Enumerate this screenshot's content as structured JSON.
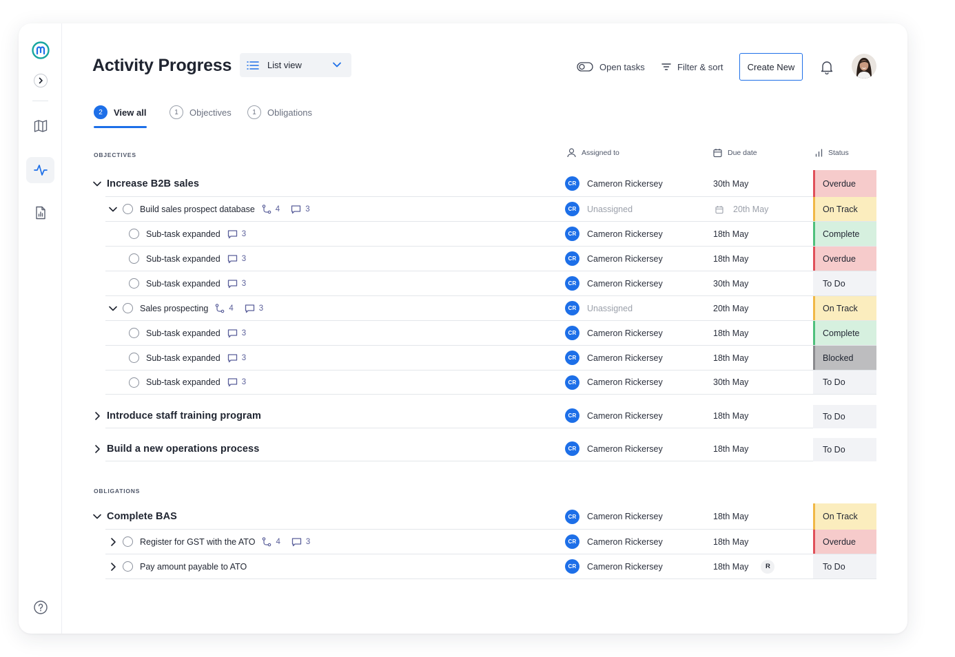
{
  "page": {
    "title": "Activity Progress",
    "view_selector": {
      "label": "List view",
      "icon": "list-icon"
    }
  },
  "header_actions": {
    "open_tasks": "Open tasks",
    "filter_sort": "Filter & sort",
    "create_new": "Create New"
  },
  "sidebar": {
    "items": [
      {
        "name": "logo",
        "icon": "logo-icon"
      },
      {
        "name": "expand",
        "icon": "chevron-right-icon"
      },
      {
        "name": "map",
        "icon": "map-icon"
      },
      {
        "name": "activity",
        "icon": "activity-icon",
        "active": true
      },
      {
        "name": "reports",
        "icon": "report-icon"
      },
      {
        "name": "help",
        "icon": "help-icon"
      }
    ]
  },
  "tabs": [
    {
      "label": "View all",
      "count": "2",
      "active": true
    },
    {
      "label": "Objectives",
      "count": "1",
      "active": false
    },
    {
      "label": "Obligations",
      "count": "1",
      "active": false
    }
  ],
  "columns": {
    "assigned": "Assigned to",
    "due": "Due date",
    "status": "Status"
  },
  "sections": {
    "objectives": "OBJECTIVES",
    "obligations": "OBLIGATIONS"
  },
  "rows": [
    {
      "name": "Increase B2B sales",
      "assignee": "Cameron Rickersey",
      "initials": "CR",
      "due": "30th May",
      "status": "Overdue"
    },
    {
      "name": "Build sales prospect database",
      "subtasks": "4",
      "comments": "3",
      "assignee": "Unassigned",
      "initials": "CR",
      "due": "20th May",
      "status": "On Track"
    },
    {
      "name": "Sub-task expanded",
      "comments": "3",
      "assignee": "Cameron Rickersey",
      "initials": "CR",
      "due": "18th May",
      "status": "Complete"
    },
    {
      "name": "Sub-task expanded",
      "comments": "3",
      "assignee": "Cameron Rickersey",
      "initials": "CR",
      "due": "18th May",
      "status": "Overdue"
    },
    {
      "name": "Sub-task expanded",
      "comments": "3",
      "assignee": "Cameron Rickersey",
      "initials": "CR",
      "due": "30th May",
      "status": "To Do"
    },
    {
      "name": "Sales prospecting",
      "subtasks": "4",
      "comments": "3",
      "assignee": "Unassigned",
      "initials": "CR",
      "due": "20th May",
      "status": "On Track"
    },
    {
      "name": "Sub-task expanded",
      "comments": "3",
      "assignee": "Cameron Rickersey",
      "initials": "CR",
      "due": "18th May",
      "status": "Complete"
    },
    {
      "name": "Sub-task expanded",
      "comments": "3",
      "assignee": "Cameron Rickersey",
      "initials": "CR",
      "due": "18th May",
      "status": "Blocked"
    },
    {
      "name": "Sub-task expanded",
      "comments": "3",
      "assignee": "Cameron Rickersey",
      "initials": "CR",
      "due": "30th May",
      "status": "To Do"
    },
    {
      "name": "Introduce staff training program",
      "assignee": "Cameron Rickersey",
      "initials": "CR",
      "due": "18th May",
      "status": "To Do"
    },
    {
      "name": "Build a new operations process",
      "assignee": "Cameron Rickersey",
      "initials": "CR",
      "due": "18th May",
      "status": "To Do"
    },
    {
      "name": "Complete BAS",
      "assignee": "Cameron Rickersey",
      "initials": "CR",
      "due": "18th May",
      "status": "On Track"
    },
    {
      "name": "Register for GST with the ATO",
      "subtasks": "4",
      "comments": "3",
      "assignee": "Cameron Rickersey",
      "initials": "CR",
      "due": "18th May",
      "status": "Overdue"
    },
    {
      "name": "Pay amount payable to ATO",
      "assignee": "Cameron Rickersey",
      "initials": "CR",
      "due": "18th May",
      "due_badge": "R",
      "status": "To Do"
    }
  ],
  "colors": {
    "accent": "#1d6fe8",
    "overdue": "#f6cbcb",
    "on_track": "#fbedbe",
    "complete": "#d6f0df",
    "blocked": "#bdbdbf",
    "todo": "#f2f3f6"
  }
}
